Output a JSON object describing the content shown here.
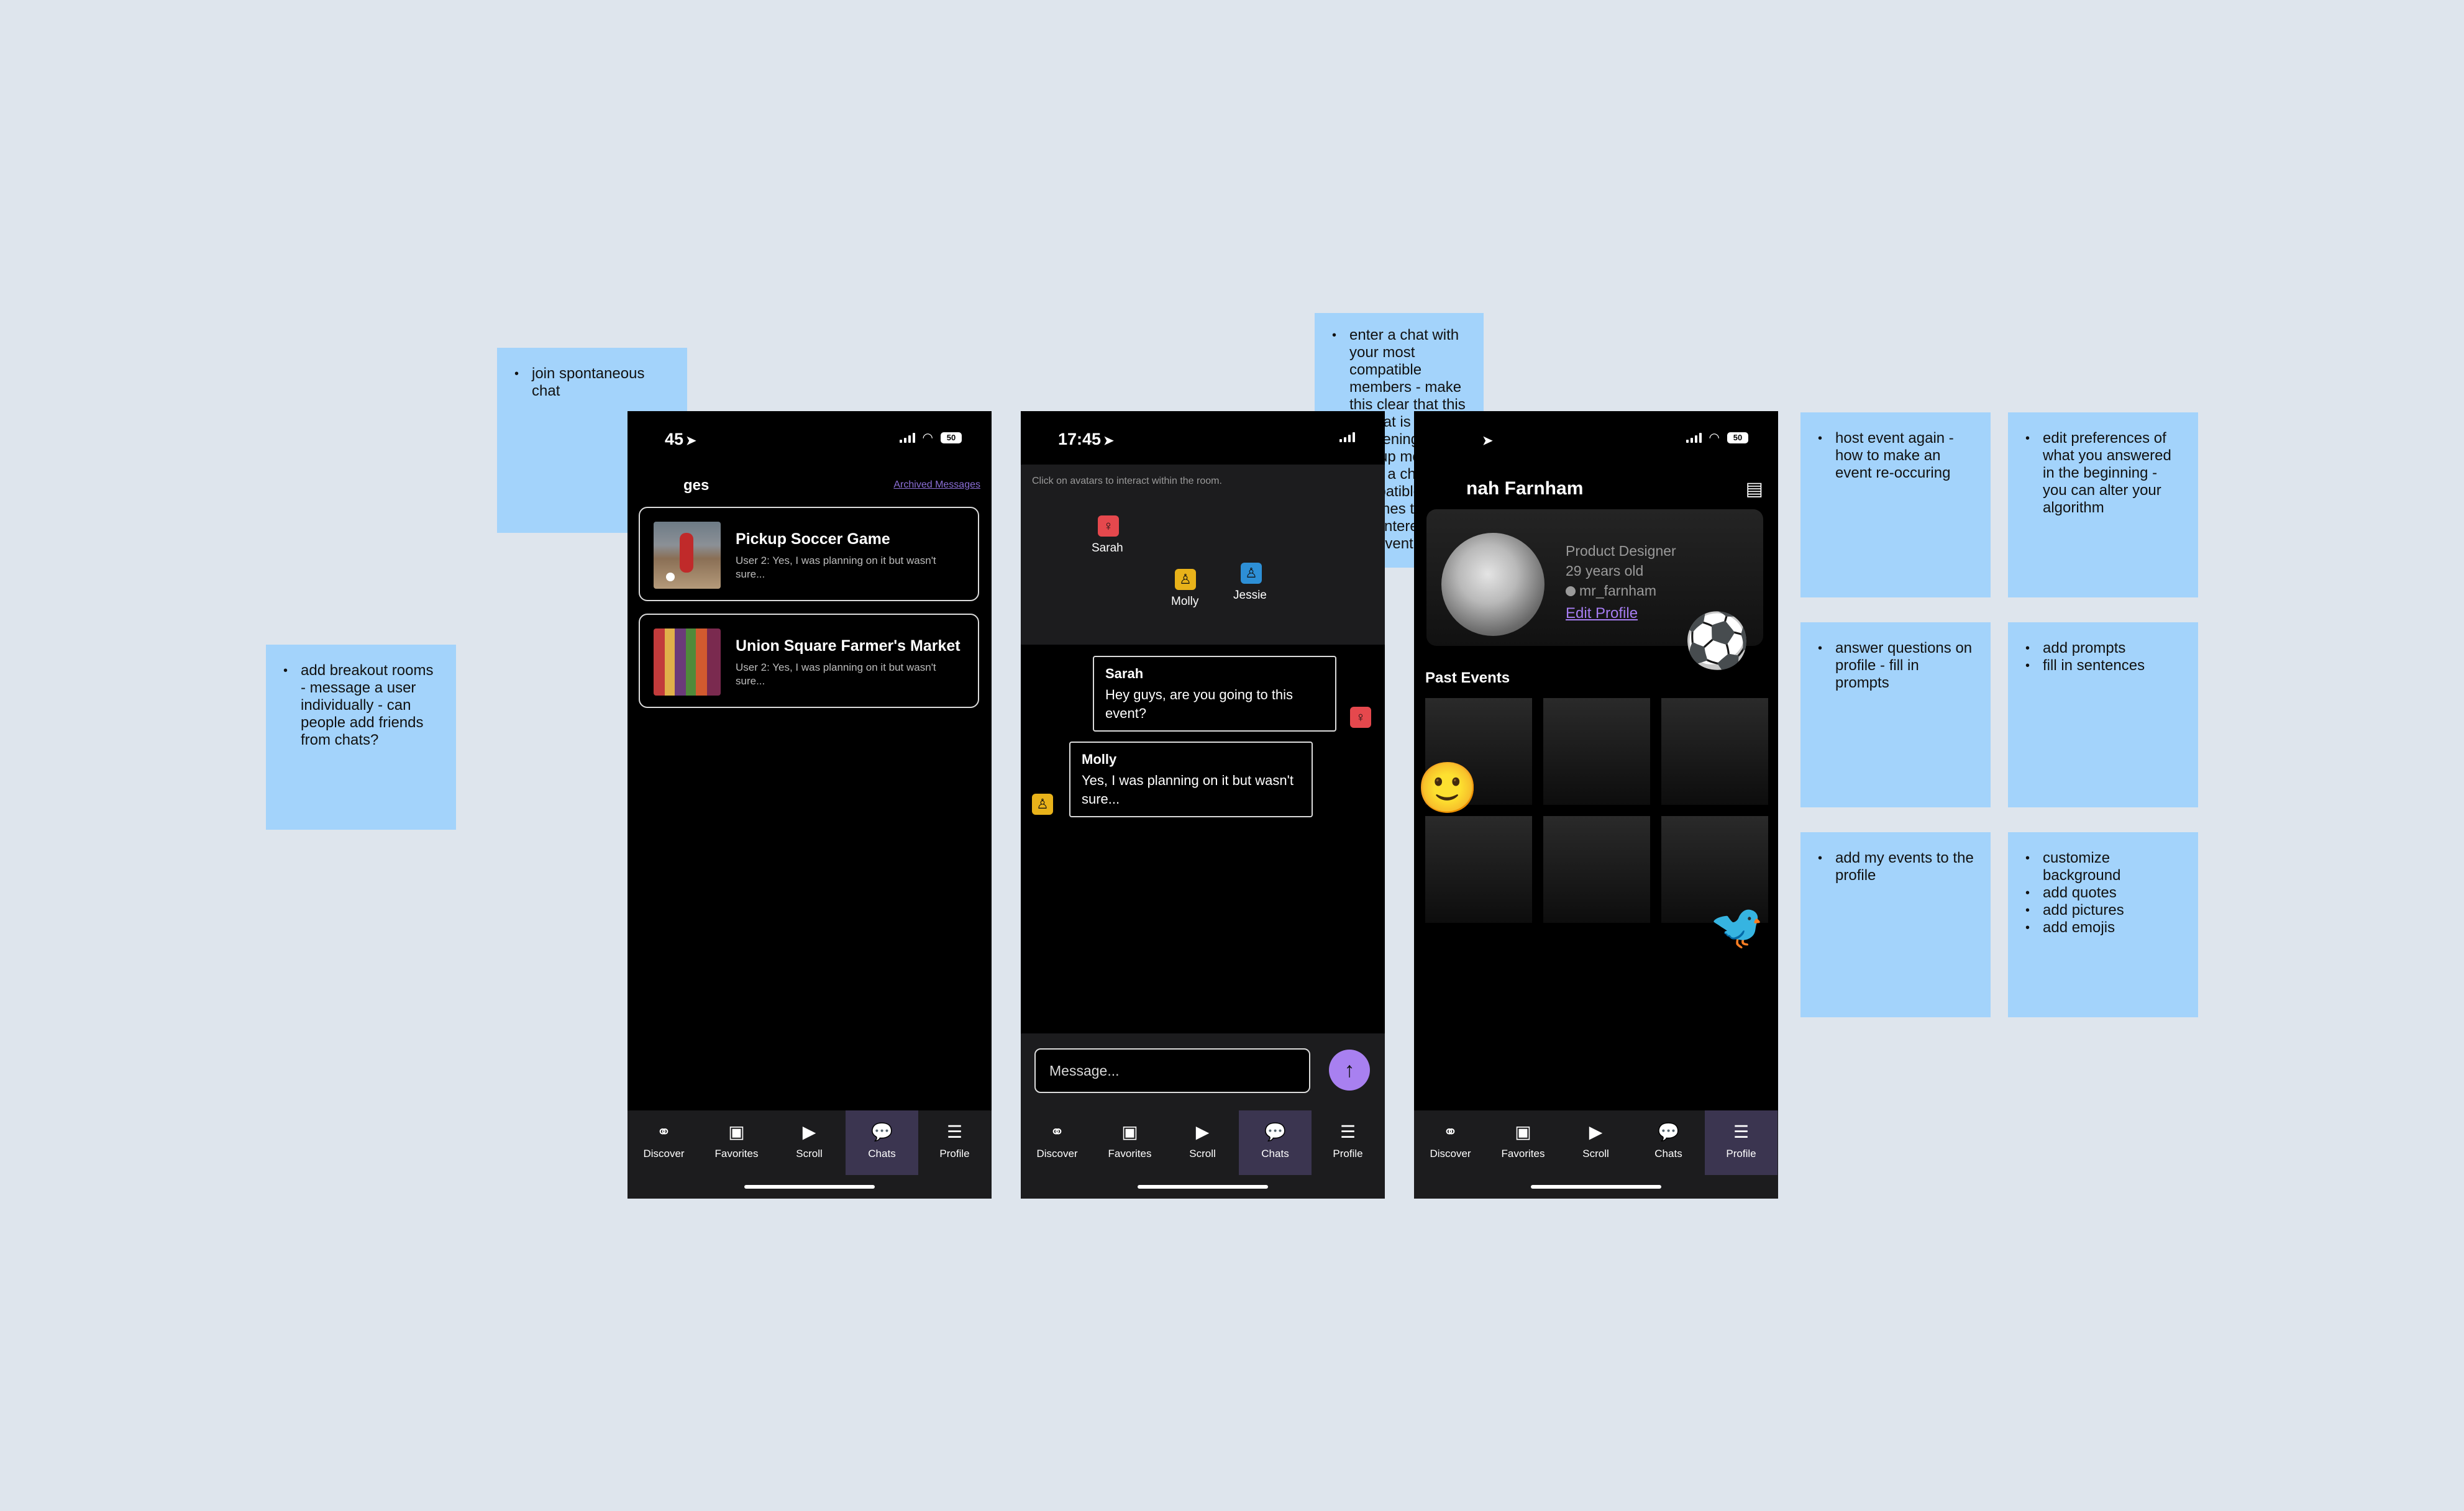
{
  "notes": {
    "n1": [
      "add breakout rooms - message a user individually - can people add friends from chats?"
    ],
    "n2": [
      "join spontaneous chat"
    ],
    "n3": [
      "enter a chat with your most compatible members - make this clear that this is what is happening",
      "pop-up modal - enter a chat with compatible matches that are also interested in this event"
    ],
    "n4": [
      "host event again - how to make an event re-occuring"
    ],
    "n5": [
      "edit preferences of what you answered in the beginning - you can alter your algorithm"
    ],
    "n6": [
      "answer questions on profile - fill in prompts"
    ],
    "n7": [
      "add prompts",
      "fill in sentences"
    ],
    "n8": [
      "add my events to the profile"
    ],
    "n9": [
      "customize background",
      "add quotes",
      "add pictures",
      "add emojis"
    ]
  },
  "status_bar": {
    "time_full": "17:45",
    "time_cut": "45",
    "battery": "50",
    "arrow": "➤",
    "wifi": "◠"
  },
  "tabs": [
    {
      "label": "Discover",
      "icon": "binoculars-icon",
      "glyph": "⚭"
    },
    {
      "label": "Favorites",
      "icon": "heart-calendar-icon",
      "glyph": "▣"
    },
    {
      "label": "Scroll",
      "icon": "play-icon",
      "glyph": "▶"
    },
    {
      "label": "Chats",
      "icon": "chat-bubble-icon",
      "glyph": "💬"
    },
    {
      "label": "Profile",
      "icon": "profile-card-icon",
      "glyph": "☰"
    }
  ],
  "messages_screen": {
    "title_cut": "ges",
    "archived_link": "Archived Messages",
    "chats": [
      {
        "title": "Pickup Soccer Game",
        "preview": "User 2: Yes, I was planning on it but wasn't sure..."
      },
      {
        "title": "Union Square Farmer's Market",
        "preview": "User 2: Yes, I was planning on it but wasn't sure..."
      }
    ]
  },
  "chat_screen": {
    "hint": "Click on avatars to interact within the room.",
    "avatars": [
      {
        "name": "Sarah",
        "color": "#e5484d",
        "glyph": "♀"
      },
      {
        "name": "Molly",
        "color": "#e8b21a",
        "glyph": "♙"
      },
      {
        "name": "Jessie",
        "color": "#2d8fd6",
        "glyph": "♙"
      }
    ],
    "messages": [
      {
        "sender": "Sarah",
        "text": "Hey guys, are you going to this event?"
      },
      {
        "sender": "Molly",
        "text": "Yes, I was planning on it but wasn't sure..."
      }
    ],
    "input_placeholder": "Message...",
    "send_glyph": "↑"
  },
  "profile_screen": {
    "name_cut": "nah Farnham",
    "role": "Product Designer",
    "age": "29 years old",
    "username": "mr_farnham",
    "edit_link": "Edit Profile",
    "past_events_header": "Past Events",
    "stickers": [
      "⚽",
      "🙂",
      "🐦"
    ],
    "menu_glyph": "▤"
  },
  "colors": {
    "background": "#dee5ed",
    "sticky": "#a3d3fb",
    "accent_purple": "#a880f0",
    "active_tab": "#3b3550"
  }
}
